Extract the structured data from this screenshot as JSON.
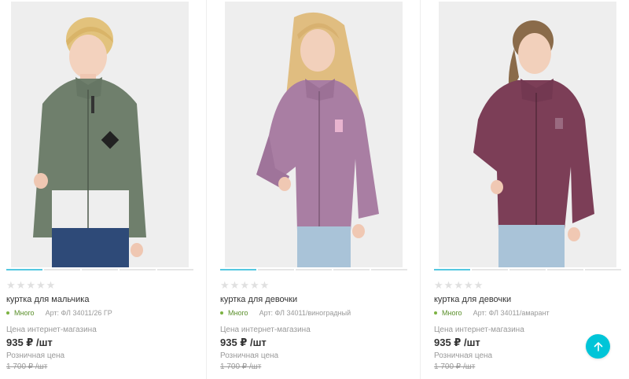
{
  "products": [
    {
      "title": "куртка для мальчика",
      "stock": "Много",
      "article": "Арт: ФЛ 34011/26 ГР",
      "price_label": "Цена интернет-магазина",
      "price": "935 ₽ /шт",
      "retail_label": "Розничная цена",
      "retail_price": "1 700 ₽ /шт",
      "rating": 0,
      "slides": 5,
      "active_slide": 0,
      "image": "boy-green-fleece-jacket",
      "jacket_color": "#6f7f6c"
    },
    {
      "title": "куртка для девочки",
      "stock": "Много",
      "article": "Арт: ФЛ 34011/виноградный",
      "price_label": "Цена интернет-магазина",
      "price": "935 ₽ /шт",
      "retail_label": "Розничная цена",
      "retail_price": "1 700 ₽ /шт",
      "rating": 0,
      "slides": 5,
      "active_slide": 0,
      "image": "girl-lilac-fleece-jacket",
      "jacket_color": "#a97ea3"
    },
    {
      "title": "куртка для девочки",
      "stock": "Много",
      "article": "Арт: ФЛ 34011/амарант",
      "price_label": "Цена интернет-магазина",
      "price": "935 ₽ /шт",
      "retail_label": "Розничная цена",
      "retail_price": "1 700 ₽ /шт",
      "rating": 0,
      "slides": 5,
      "active_slide": 0,
      "image": "girl-maroon-fleece-jacket",
      "jacket_color": "#7c3e57"
    }
  ],
  "colors": {
    "accent": "#00c5d8",
    "stock_green": "#7cb342",
    "slider_active": "#55c8e0"
  },
  "scroll_up_icon": "arrow-up-icon"
}
